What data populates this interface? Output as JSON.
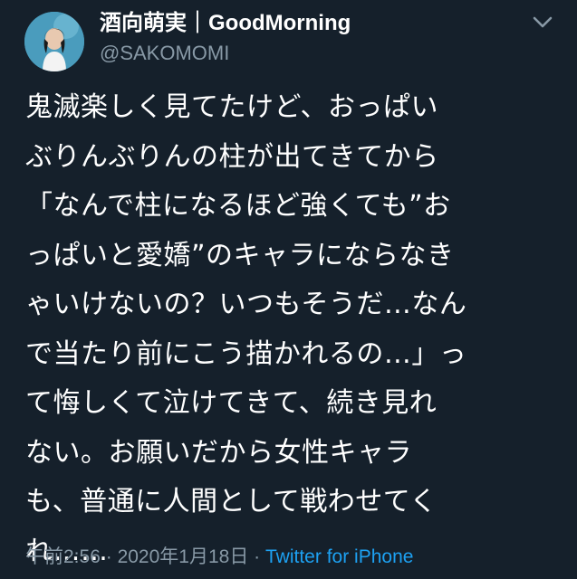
{
  "tweet": {
    "display_name": "酒向萌実｜GoodMorning",
    "handle": "@SAKOMOMI",
    "avatar_icon": "user-avatar-photo",
    "menu_icon": "chevron-down-icon",
    "text_lines": [
      "鬼滅楽しく見てたけど、おっぱい",
      "ぶりんぶりんの柱が出てきてから",
      "「なんで柱になるほど強くても”お",
      "っぱいと愛嬌”のキャラにならなき",
      "ゃいけないの？いつもそうだ…なん",
      "で当たり前にこう描かれるの…」っ",
      "て悔しくて泣けてきて、続き見れ",
      "ない。お願いだから女性キャラ",
      "も、普通に人間として戦わせてく",
      "れ……"
    ],
    "time": "午前2:56",
    "separator": "·",
    "date": "2020年1月18日",
    "source": "Twitter for iPhone"
  },
  "colors": {
    "background": "#15202b",
    "text": "#ffffff",
    "secondary": "#8899a6",
    "link": "#1da1f2"
  }
}
